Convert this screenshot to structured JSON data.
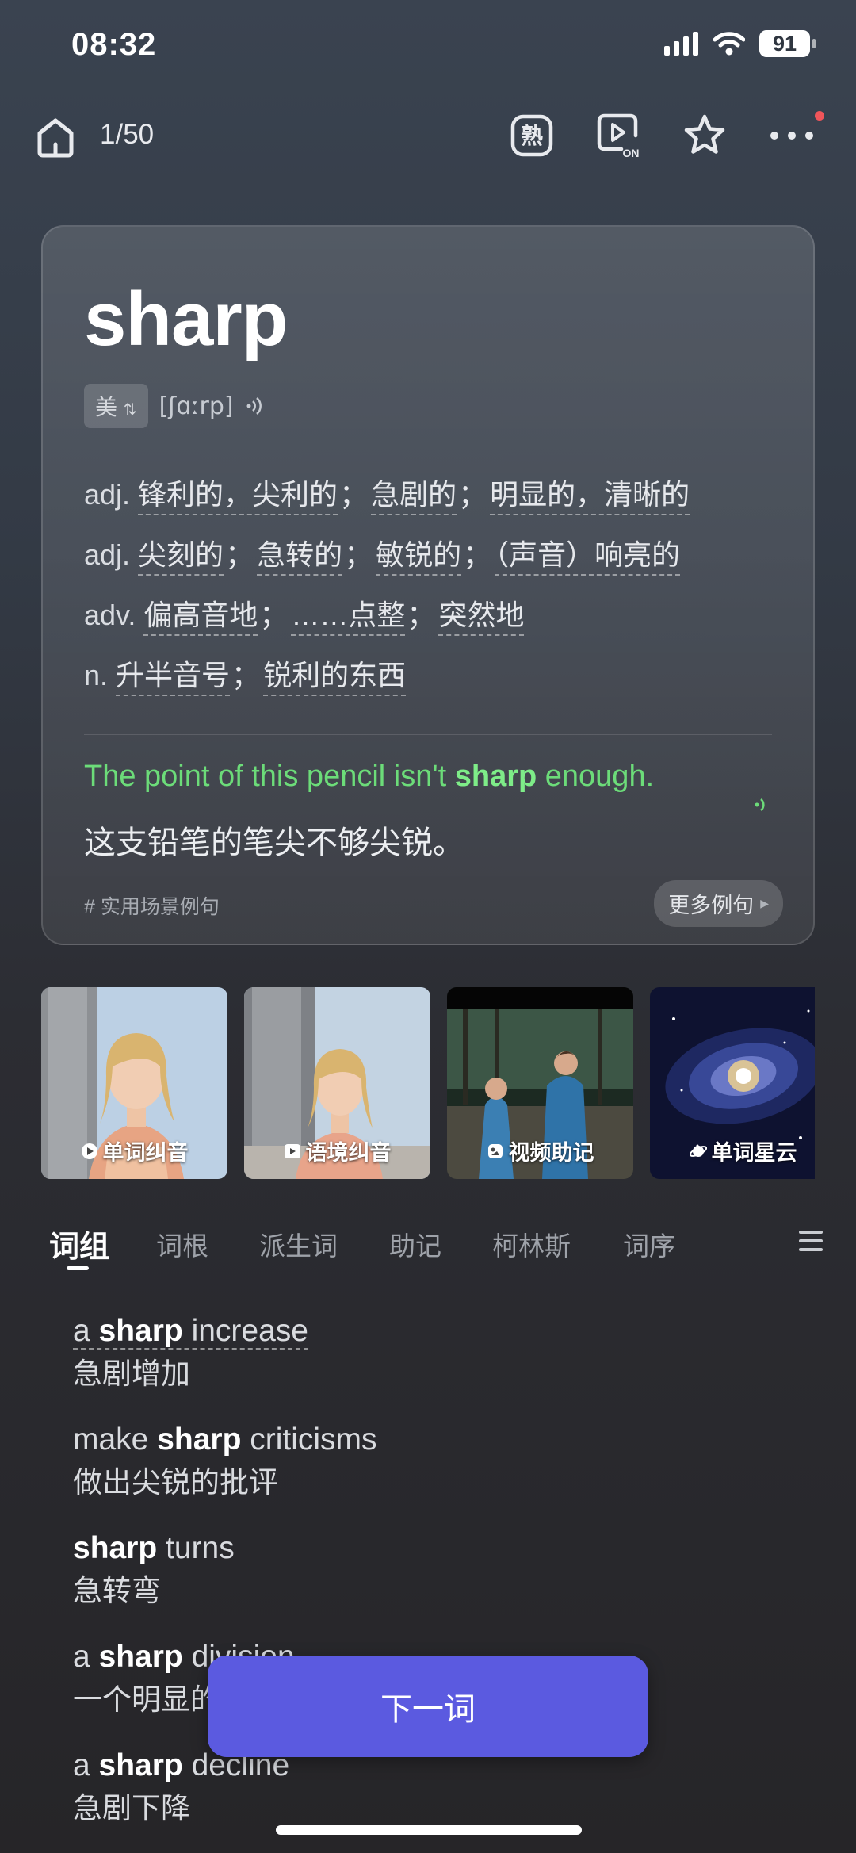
{
  "status": {
    "time": "08:32",
    "battery": "91"
  },
  "top_bar": {
    "progress": "1/50",
    "familiar_glyph": "熟",
    "video_badge": "ON"
  },
  "word_card": {
    "word": "sharp",
    "region": "美",
    "phonetic": "[ʃɑːrp]",
    "definitions": [
      {
        "pos": "adj.",
        "meanings": [
          "锋利的，尖利的",
          "急剧的",
          "明显的，清晰的"
        ]
      },
      {
        "pos": "adj.",
        "meanings": [
          "尖刻的",
          "急转的",
          "敏锐的",
          "（声音）响亮的"
        ]
      },
      {
        "pos": "adv.",
        "meanings": [
          "偏高音地",
          "……点整",
          "突然地"
        ]
      },
      {
        "pos": "n.",
        "meanings": [
          "升半音号",
          "锐利的东西"
        ]
      }
    ],
    "example": {
      "before": "The point of this pencil isn't ",
      "keyword": "sharp",
      "after": " enough.",
      "translation": "这支铅笔的笔尖不够尖锐。"
    },
    "tag": "# 实用场景例句",
    "more_examples": "更多例句"
  },
  "media": [
    {
      "label": "单词纠音",
      "icon": "play-icon"
    },
    {
      "label": "语境纠音",
      "icon": "video-icon"
    },
    {
      "label": "视频助记",
      "icon": "brain-icon"
    },
    {
      "label": "单词星云",
      "icon": "planet-icon"
    }
  ],
  "tabs": [
    "词组",
    "词根",
    "派生词",
    "助记",
    "柯林斯",
    "词序"
  ],
  "phrases": [
    {
      "pre": "a ",
      "key": "sharp",
      "post": " increase",
      "zh": "急剧增加"
    },
    {
      "pre": "make ",
      "key": "sharp",
      "post": " criticisms",
      "zh": "做出尖锐的批评"
    },
    {
      "pre": "",
      "key": "sharp",
      "post": " turns",
      "zh": "急转弯"
    },
    {
      "pre": "a ",
      "key": "sharp",
      "post": " division",
      "zh": "一个明显的分歧"
    },
    {
      "pre": "a ",
      "key": "sharp",
      "post": " decline",
      "zh": "急剧下降"
    }
  ],
  "next_button": "下一词",
  "colors": {
    "accent": "#5b5ae0",
    "example_green": "#6cdc79",
    "notification": "#f0555a"
  }
}
